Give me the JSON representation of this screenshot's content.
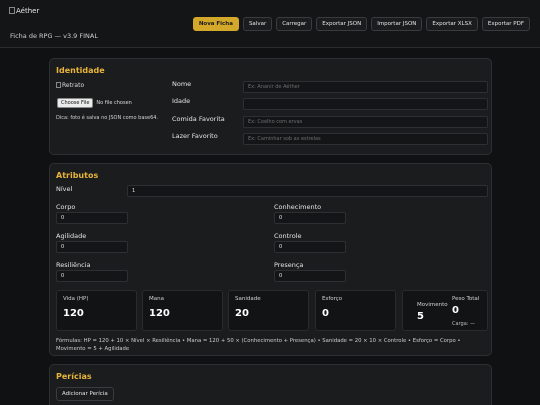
{
  "app": {
    "logo_alt": "Aéther",
    "subtitle": "Ficha de RPG — v3.9 FINAL"
  },
  "toolbar": {
    "buttons": [
      "Nova Ficha",
      "Salvar",
      "Carregar",
      "Exportar JSON",
      "Importar JSON",
      "Exportar XLSX",
      "Exportar PDF"
    ]
  },
  "identidade": {
    "title": "Identidade",
    "photo_alt": "Retrato",
    "file_button": "Choose File",
    "file_status": "No file chosen",
    "tip": "Dica: foto é salva no JSON como base64.",
    "fields": [
      {
        "label": "Nome",
        "placeholder": "Ex: Ananir de Aéther",
        "value": ""
      },
      {
        "label": "Idade",
        "placeholder": "",
        "value": ""
      },
      {
        "label": "Comida Favorita",
        "placeholder": "Ex: Coelho com ervas",
        "value": ""
      },
      {
        "label": "Lazer Favorito",
        "placeholder": "Ex: Caminhar sob as estrelas",
        "value": ""
      }
    ]
  },
  "atributos": {
    "title": "Atributos",
    "nivel_label": "Nível",
    "nivel_value": "1",
    "attrs": [
      {
        "label": "Corpo",
        "value": "0"
      },
      {
        "label": "Conhecimento",
        "value": "0"
      },
      {
        "label": "Agilidade",
        "value": "0"
      },
      {
        "label": "Controle",
        "value": "0"
      },
      {
        "label": "Resiliência",
        "value": "0"
      },
      {
        "label": "Presença",
        "value": "0"
      }
    ],
    "stats": [
      {
        "name": "Vida (HP)",
        "value": "120"
      },
      {
        "name": "Mana",
        "value": "120"
      },
      {
        "name": "Sanidade",
        "value": "20"
      },
      {
        "name": "Esforço",
        "value": "0"
      }
    ],
    "movimento_label": "Movimento",
    "movimento_value": "5",
    "peso_label": "Peso Total",
    "peso_value": "0",
    "carga_label": "Carga: —",
    "formula": "Fórmulas: HP = 120 + 10 × Nível × Resiliência • Mana = 120 + 50 × (Conhecimento + Presença) • Sanidade = 20 × 10 × Controle • Esforço = Corpo • Movimento = 5 + Agilidade"
  },
  "pericias": {
    "title": "Perícias",
    "add_button": "Adicionar Perícia"
  }
}
